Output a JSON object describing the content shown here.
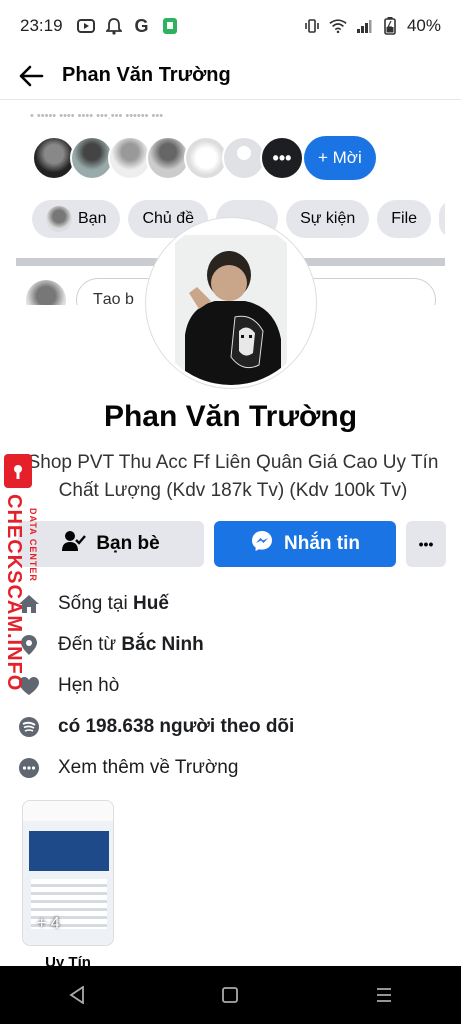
{
  "status_bar": {
    "time": "23:19",
    "battery": "40%"
  },
  "header": {
    "title": "Phan Văn Trường"
  },
  "group_preview": {
    "invite_label": "+ Mời",
    "more_label": "•••",
    "chips": [
      "Bạn",
      "Chủ đề",
      "Sự kiện",
      "File"
    ],
    "compose_placeholder": "Tạo b"
  },
  "profile": {
    "name": "Phan Văn Trường",
    "bio": "Shop PVT Thu Acc Ff Liên Quân Giá Cao Uy Tín Chất Lượng (Kdv 187k Tv) (Kdv 100k Tv)"
  },
  "actions": {
    "friends_label": "Bạn bè",
    "message_label": "Nhắn tin",
    "more_label": "•••"
  },
  "details": {
    "lives_prefix": "Sống tại ",
    "lives_place": "Huế",
    "from_prefix": "Đến từ ",
    "from_place": "Bắc Ninh",
    "dating": "Hẹn hò",
    "followers": "có 198.638 người theo dõi",
    "see_more": "Xem thêm về Trường"
  },
  "featured": {
    "count": "+ 4",
    "label": "Uy Tín"
  },
  "watermark": {
    "brand": "CHECKSCAM.INFO",
    "sub": "DATA CENTER"
  },
  "colors": {
    "accent": "#1b74e4",
    "chip_bg": "#e4e6eb",
    "watermark": "#e4202a"
  }
}
